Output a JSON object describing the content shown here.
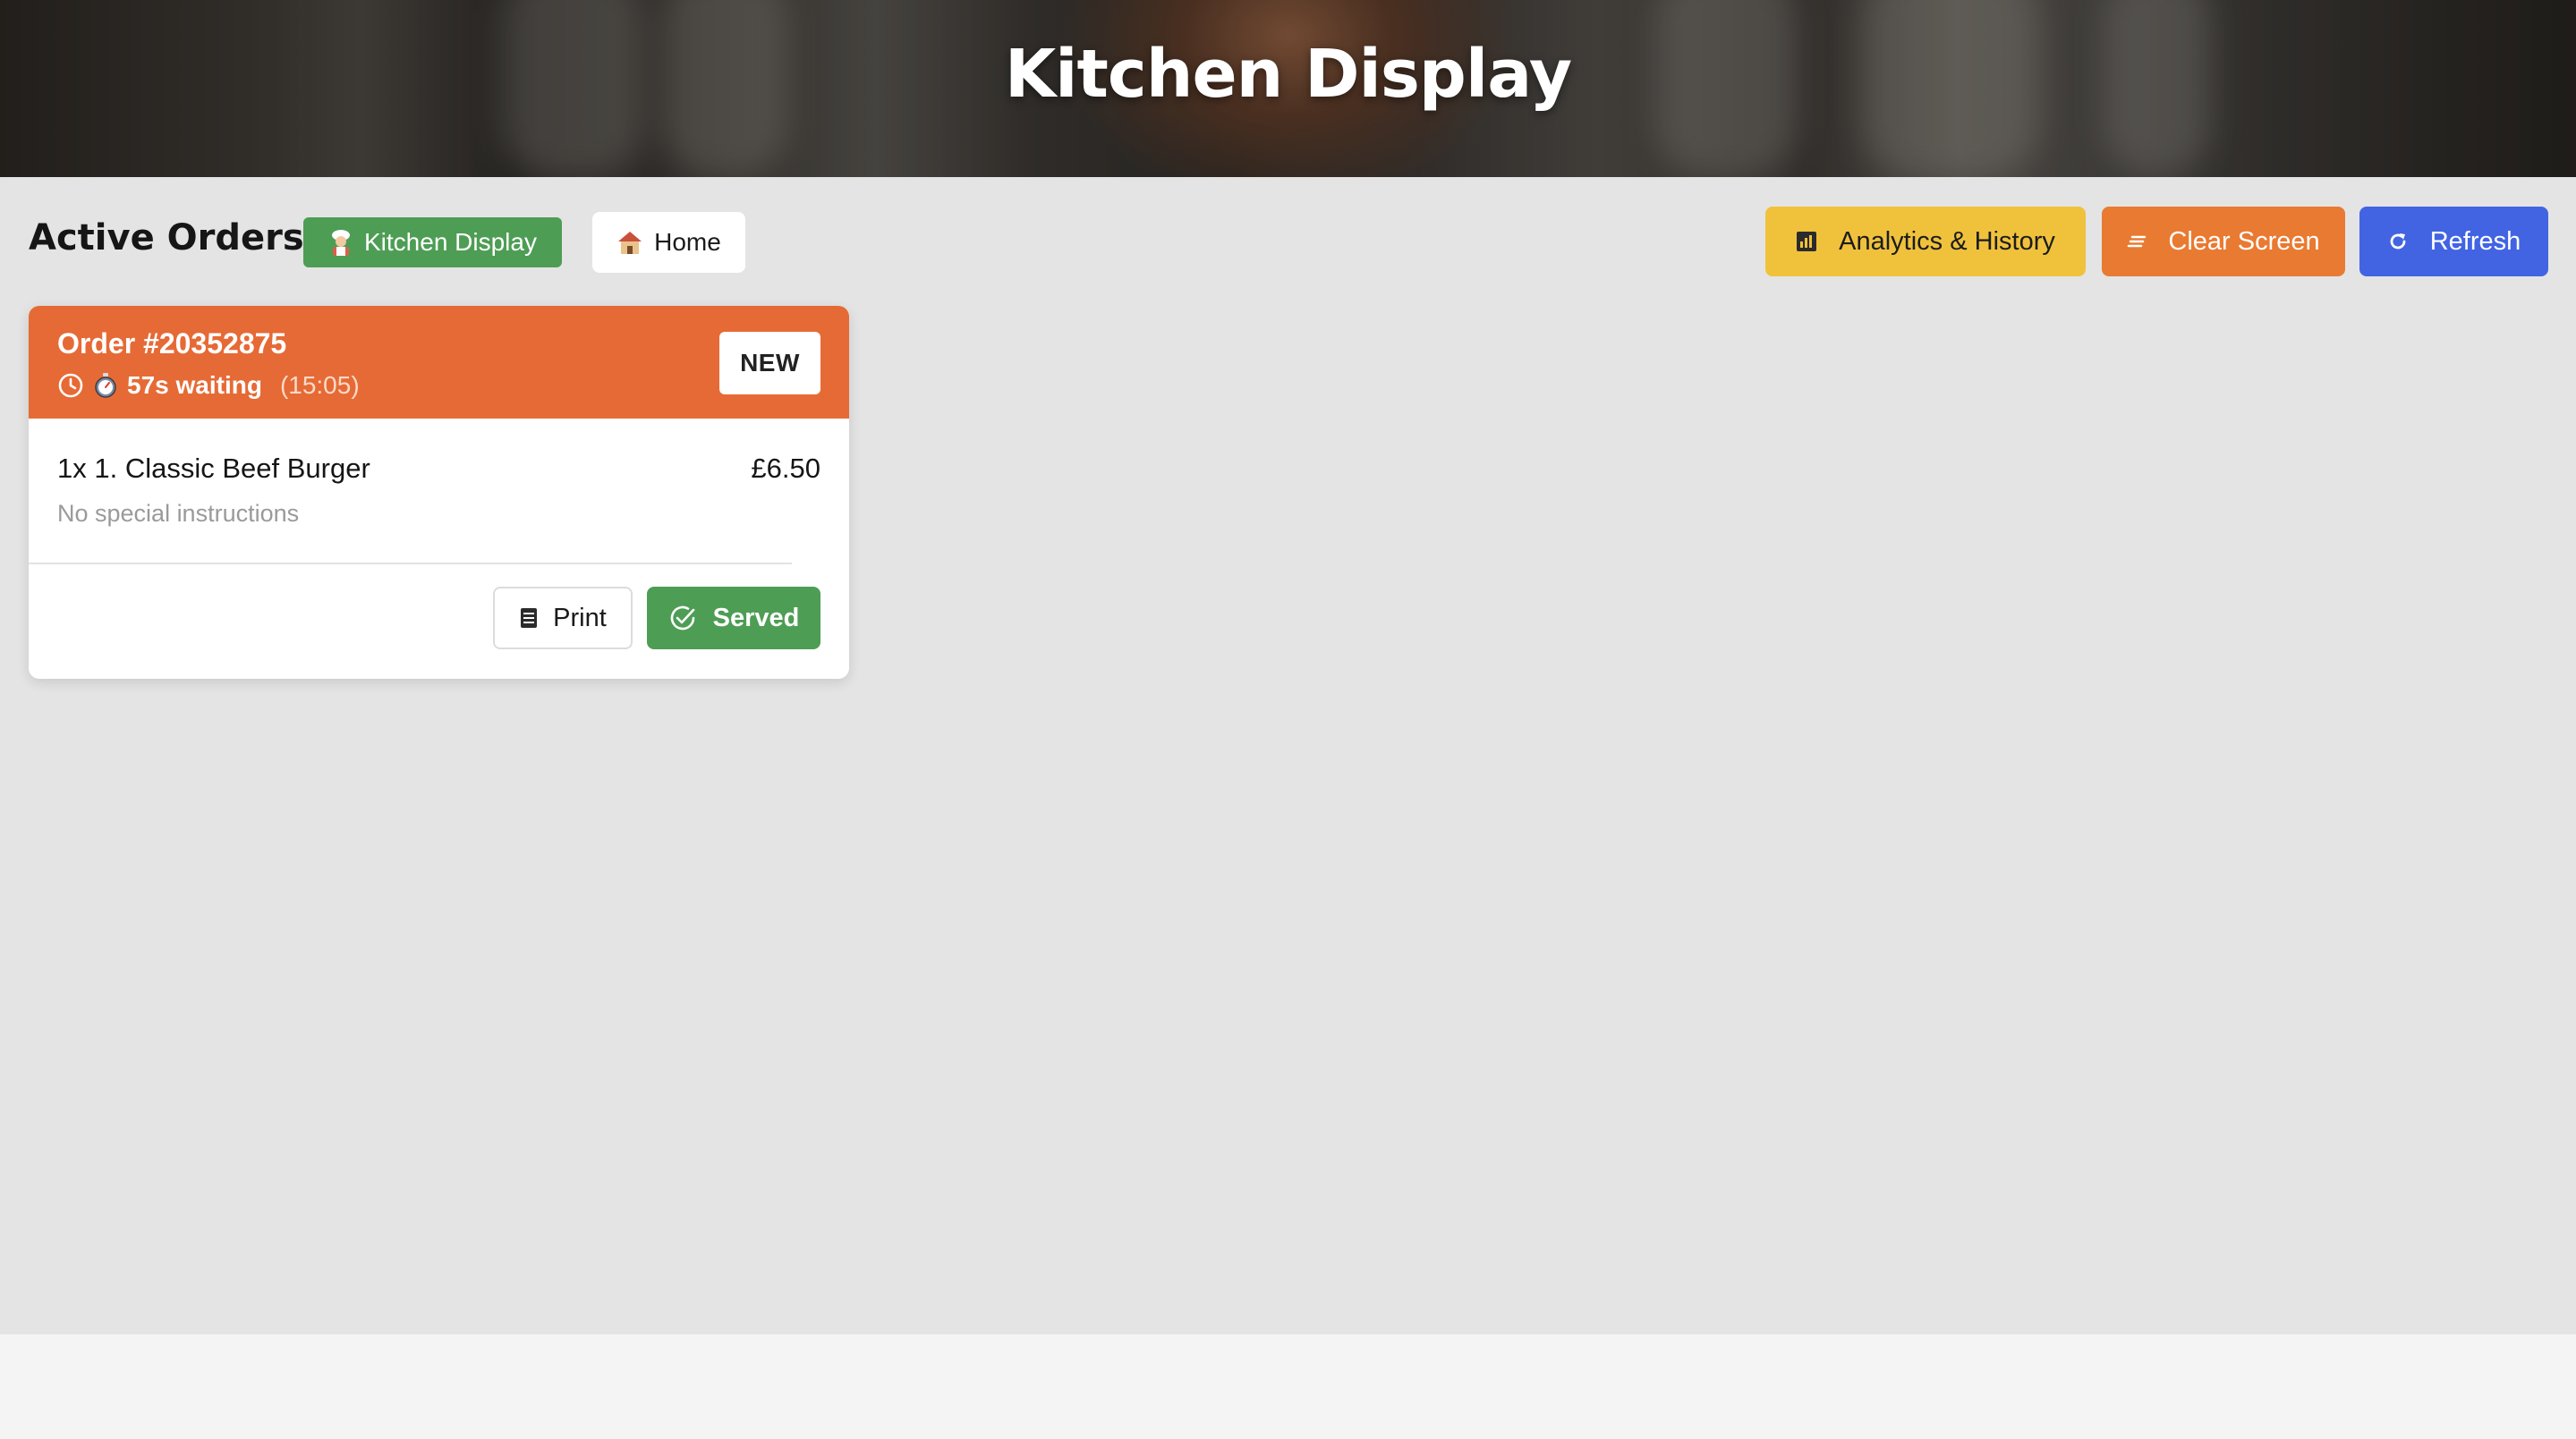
{
  "header": {
    "title": "Kitchen Display"
  },
  "toolbar": {
    "title": "Active Orders",
    "kitchen_display_label": "Kitchen Display",
    "kitchen_display_icon": "cook-emoji-icon",
    "home_label": "Home",
    "home_icon": "house-emoji-icon",
    "analytics_label": "Analytics & History",
    "analytics_icon": "bar-chart-icon",
    "clear_label": "Clear Screen",
    "clear_icon": "clear-lines-icon",
    "refresh_label": "Refresh",
    "refresh_icon": "refresh-icon"
  },
  "orders": [
    {
      "order_number": "Order #20352875",
      "status": "NEW",
      "waiting": "57s waiting",
      "placed_time": "(15:05)",
      "items": [
        {
          "name": "1x 1. Classic Beef Burger",
          "price": "£6.50",
          "note": "No special instructions"
        }
      ],
      "print_label": "Print",
      "served_label": "Served"
    }
  ],
  "colors": {
    "order_header": "#e66a35",
    "kitchen_display_active": "#4e9d55",
    "analytics": "#f0c23c",
    "clear_screen": "#e97a32",
    "refresh": "#4264e3",
    "served": "#4e9d55"
  }
}
